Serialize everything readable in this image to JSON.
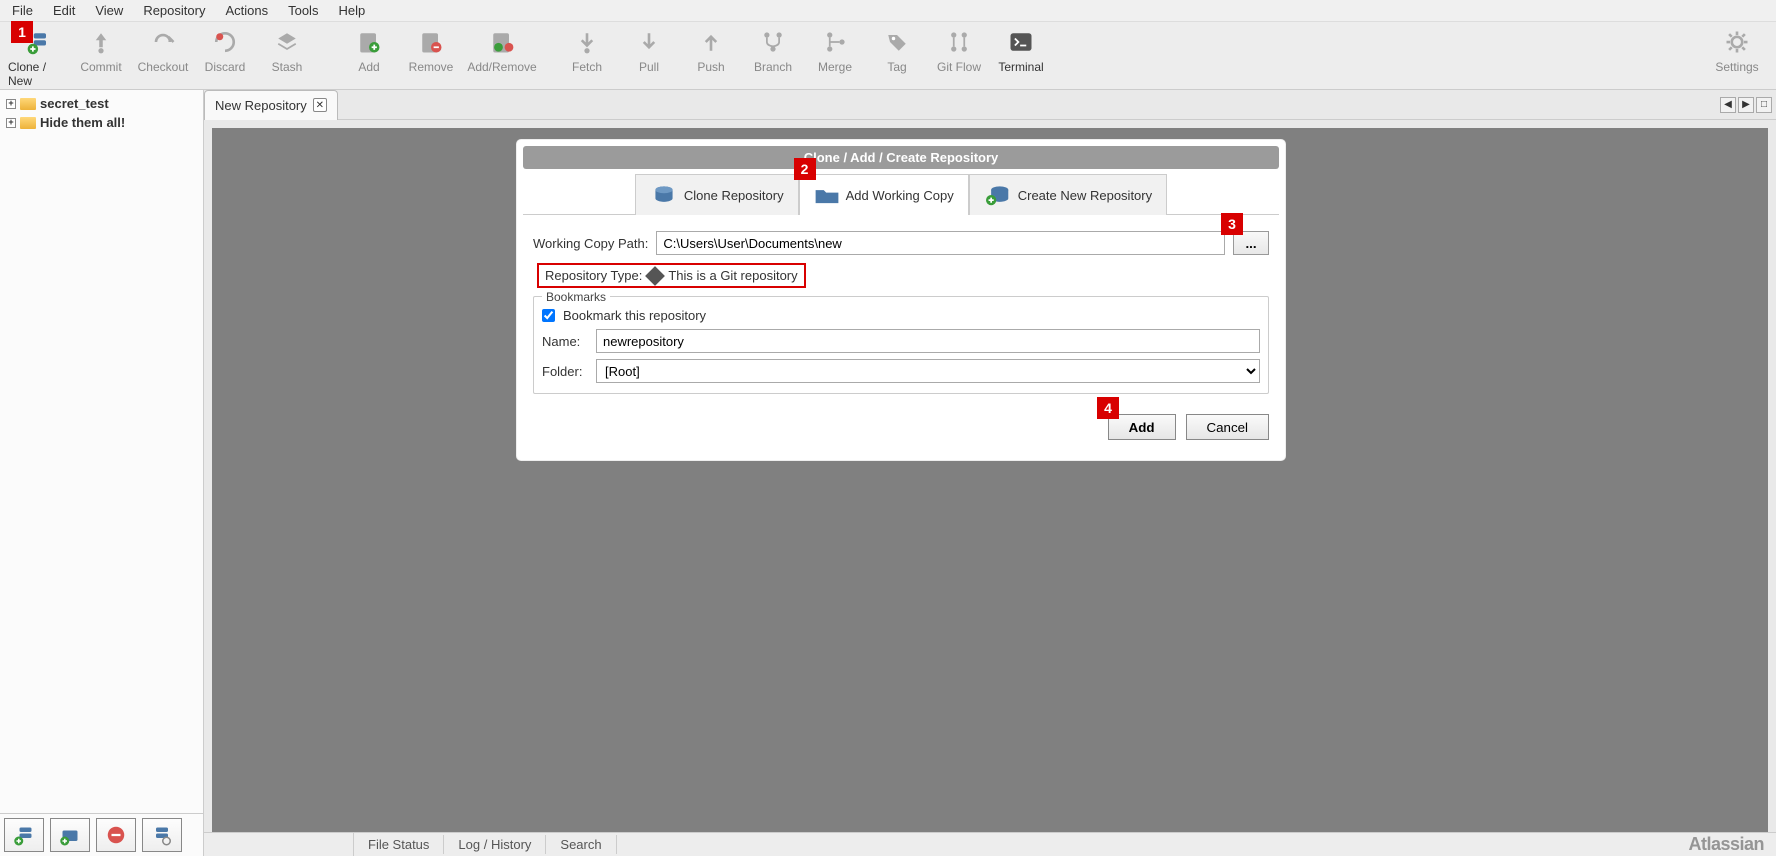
{
  "menubar": [
    "File",
    "Edit",
    "View",
    "Repository",
    "Actions",
    "Tools",
    "Help"
  ],
  "toolbar": {
    "clone_new": "Clone / New",
    "commit": "Commit",
    "checkout": "Checkout",
    "discard": "Discard",
    "stash": "Stash",
    "add": "Add",
    "remove": "Remove",
    "add_remove": "Add/Remove",
    "fetch": "Fetch",
    "pull": "Pull",
    "push": "Push",
    "branch": "Branch",
    "merge": "Merge",
    "tag": "Tag",
    "git_flow": "Git Flow",
    "terminal": "Terminal",
    "settings": "Settings"
  },
  "sidebar_tree": [
    {
      "label": "secret_test"
    },
    {
      "label": "Hide them all!"
    }
  ],
  "tab": {
    "label": "New Repository"
  },
  "dialog": {
    "title": "Clone  / Add / Create Repository",
    "tabs": {
      "clone": "Clone Repository",
      "add": "Add Working Copy",
      "create": "Create New Repository"
    },
    "path_label": "Working Copy Path:",
    "path_value": "C:\\Users\\User\\Documents\\new",
    "browse_label": "...",
    "repo_type_label": "Repository Type:",
    "repo_type_text": "This is a Git repository",
    "bookmarks_legend": "Bookmarks",
    "bookmark_check": "Bookmark this repository",
    "name_label": "Name:",
    "name_value": "newrepository",
    "folder_label": "Folder:",
    "folder_value": "[Root]",
    "btn_add": "Add",
    "btn_cancel": "Cancel"
  },
  "status": [
    "File Status",
    "Log / History",
    "Search"
  ],
  "brand": "Atlassian",
  "callouts": {
    "1": "1",
    "2": "2",
    "3": "3",
    "4": "4"
  }
}
